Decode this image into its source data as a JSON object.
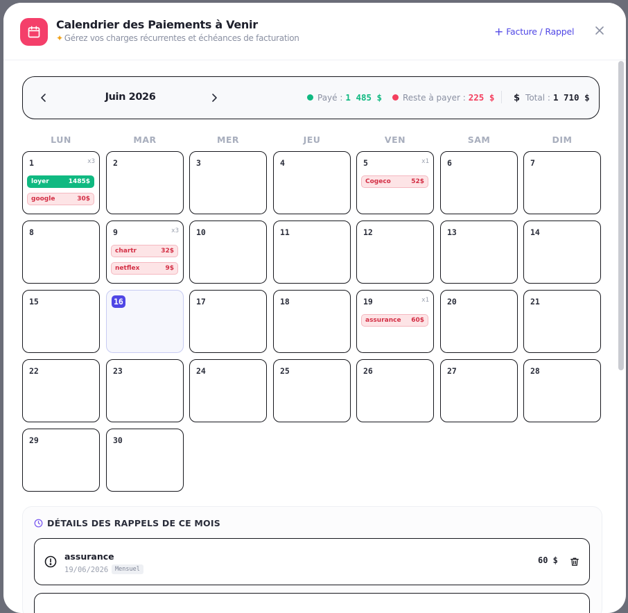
{
  "header": {
    "title": "Calendrier des Paiements à Venir",
    "subtitle": "Gérez vos charges récurrentes et échéances de facturation",
    "add_label": "Facture / Rappel",
    "icon": "calendar-icon"
  },
  "month_bar": {
    "label": "Juin 2026",
    "paid_label": "Payé :",
    "paid_value": "1 485 $",
    "remaining_label": "Reste à payer :",
    "remaining_value": "225 $",
    "total_label": "Total :",
    "total_value": "1 710 $",
    "colors": {
      "paid": "#10b981",
      "remaining": "#f43f5e",
      "accent": "#4f46e5"
    }
  },
  "weekdays": [
    "LUN",
    "MAR",
    "MER",
    "JEU",
    "VEN",
    "SAM",
    "DIM"
  ],
  "today": "16",
  "days": [
    {
      "num": "1",
      "count": "x3",
      "items": [
        {
          "name": "loyer",
          "amount": "1485$",
          "status": "paid"
        },
        {
          "name": "google",
          "amount": "30$",
          "status": "due"
        }
      ]
    },
    {
      "num": "2"
    },
    {
      "num": "3"
    },
    {
      "num": "4"
    },
    {
      "num": "5",
      "count": "x1",
      "items": [
        {
          "name": "Cogeco",
          "amount": "52$",
          "status": "due"
        }
      ]
    },
    {
      "num": "6"
    },
    {
      "num": "7"
    },
    {
      "num": "8"
    },
    {
      "num": "9",
      "count": "x3",
      "items": [
        {
          "name": "chartr",
          "amount": "32$",
          "status": "due"
        },
        {
          "name": "netflex",
          "amount": "9$",
          "status": "due"
        }
      ]
    },
    {
      "num": "10"
    },
    {
      "num": "11"
    },
    {
      "num": "12"
    },
    {
      "num": "13"
    },
    {
      "num": "14"
    },
    {
      "num": "15"
    },
    {
      "num": "16"
    },
    {
      "num": "17"
    },
    {
      "num": "18"
    },
    {
      "num": "19",
      "count": "x1",
      "items": [
        {
          "name": "assurance",
          "amount": "60$",
          "status": "due"
        }
      ]
    },
    {
      "num": "20"
    },
    {
      "num": "21"
    },
    {
      "num": "22"
    },
    {
      "num": "23"
    },
    {
      "num": "24"
    },
    {
      "num": "25"
    },
    {
      "num": "26"
    },
    {
      "num": "27"
    },
    {
      "num": "28"
    },
    {
      "num": "29"
    },
    {
      "num": "30"
    }
  ],
  "details": {
    "title": "DÉTAILS DES RAPPELS DE CE MOIS",
    "reminders": [
      {
        "name": "assurance",
        "date": "19/06/2026",
        "frequency": "Mensuel",
        "amount": "60 $"
      }
    ]
  }
}
